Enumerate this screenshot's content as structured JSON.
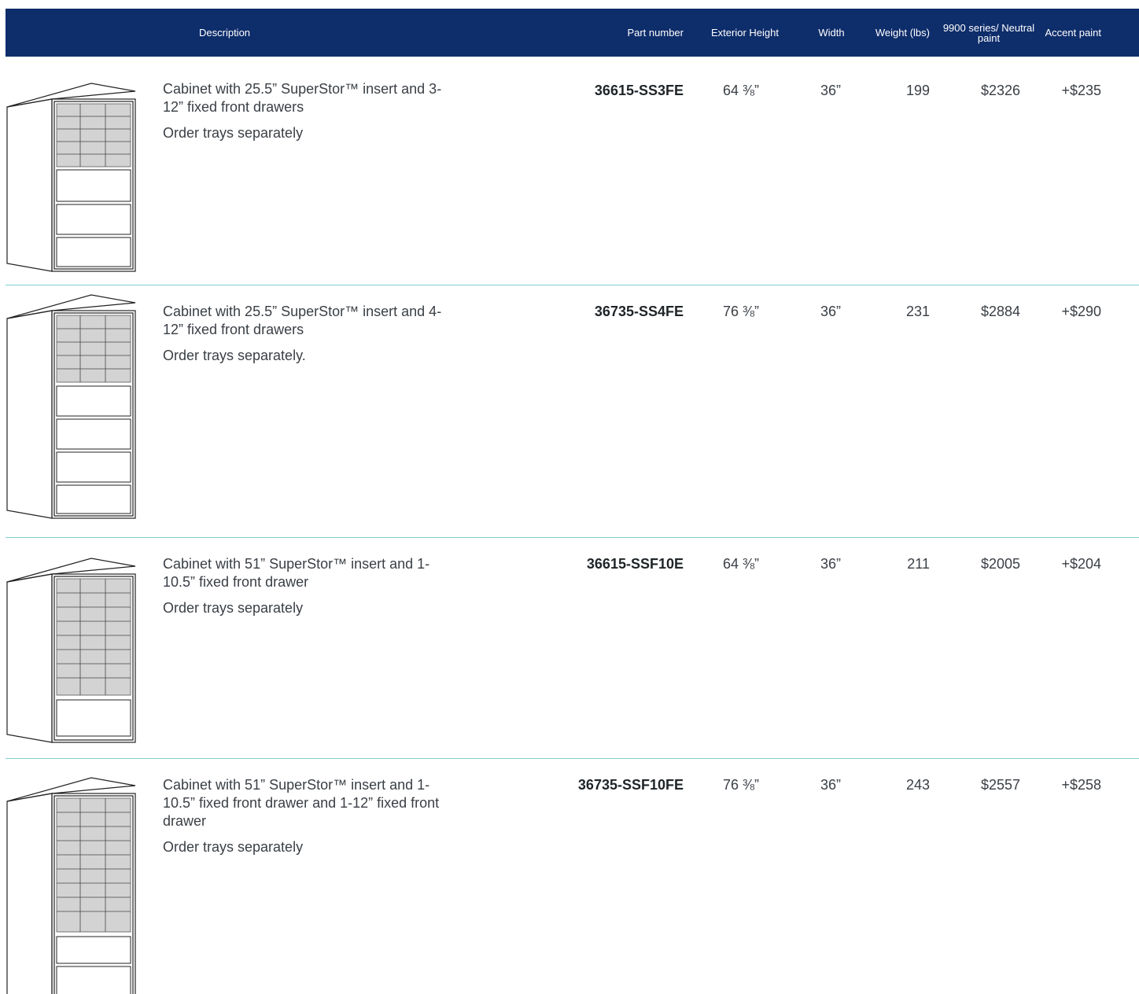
{
  "header": {
    "description": "Description",
    "part_number": "Part number",
    "exterior_height": "Exterior Height",
    "width": "Width",
    "weight": "Weight (lbs)",
    "neutral_paint": "9900 series/ Neutral paint",
    "accent_paint": "Accent paint"
  },
  "rows": [
    {
      "description": "Cabinet with 25.5” SuperStor™ insert and 3-12” fixed front drawers",
      "note": "Order trays separately",
      "part_number": "36615-SS3FE",
      "height": "64 ⅜”",
      "width": "36”",
      "weight": "199",
      "neutral_price": "$2326",
      "accent_price": "+$235"
    },
    {
      "description": "Cabinet with 25.5” SuperStor™ insert and 4-12” fixed front drawers",
      "note": "Order trays separately.",
      "part_number": "36735-SS4FE",
      "height": "76 ⅜”",
      "width": "36”",
      "weight": "231",
      "neutral_price": "$2884",
      "accent_price": "+$290"
    },
    {
      "description": "Cabinet with 51” SuperStor™ insert and 1-10.5” fixed front drawer",
      "note": "Order trays separately",
      "part_number": "36615-SSF10E",
      "height": "64 ⅜”",
      "width": "36”",
      "weight": "211",
      "neutral_price": "$2005",
      "accent_price": "+$204"
    },
    {
      "description": "Cabinet with 51” SuperStor™ insert and 1-10.5” fixed front drawer and 1-12” fixed front drawer",
      "note": "Order trays separately",
      "part_number": "36735-SSF10FE",
      "height": "76 ⅜”",
      "width": "36”",
      "weight": "243",
      "neutral_price": "$2557",
      "accent_price": "+$258"
    }
  ],
  "colors": {
    "header_bg": "#0e2d6b",
    "divider": "#7fcfd6"
  }
}
